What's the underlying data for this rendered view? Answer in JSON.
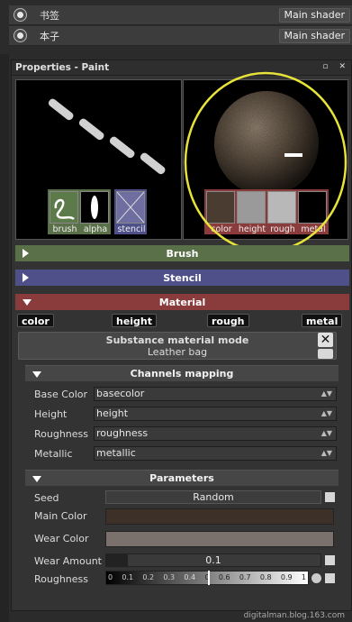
{
  "layers": [
    {
      "name": "书签",
      "shader": "Main shader"
    },
    {
      "name": "本子",
      "shader": "Main shader"
    }
  ],
  "panel": {
    "title": "Properties - Paint",
    "float_btn": "▫",
    "close_btn": "✕"
  },
  "thumbs": {
    "brush": "brush",
    "alpha": "alpha",
    "stencil": "stencil",
    "material_color": "color",
    "material_height": "height",
    "material_rough": "rough",
    "material_metal": "metal"
  },
  "sections": {
    "brush": "Brush",
    "stencil": "Stencil",
    "material": "Material"
  },
  "channel_tags": [
    "color",
    "height",
    "rough",
    "metal"
  ],
  "substance": {
    "title": "Substance material mode",
    "value": "Leather bag",
    "close": "✕"
  },
  "channels_mapping": {
    "title": "Channels mapping",
    "rows": [
      {
        "label": "Base Color",
        "value": "basecolor"
      },
      {
        "label": "Height",
        "value": "height"
      },
      {
        "label": "Roughness",
        "value": "roughness"
      },
      {
        "label": "Metallic",
        "value": "metallic"
      }
    ]
  },
  "parameters": {
    "title": "Parameters",
    "seed_label": "Seed",
    "seed_button": "Random",
    "main_color_label": "Main Color",
    "wear_color_label": "Wear Color",
    "wear_amount_label": "Wear Amount",
    "wear_amount_value": "0.1",
    "roughness_label": "Roughness",
    "roughness_ticks": [
      "0",
      "0.1",
      "0.2",
      "0.3",
      "0.4",
      "0",
      "0.6",
      "0.7",
      "0.8",
      "0.9",
      "1"
    ]
  },
  "colors": {
    "brush_section": "#5a7048",
    "stencil_section": "#4f4f8a",
    "material_section": "#8a3b3b",
    "main_color": "#3d3028",
    "wear_color": "#7a716c",
    "highlight": "#e8e33a"
  },
  "watermark": "digitalman.blog.163.com"
}
